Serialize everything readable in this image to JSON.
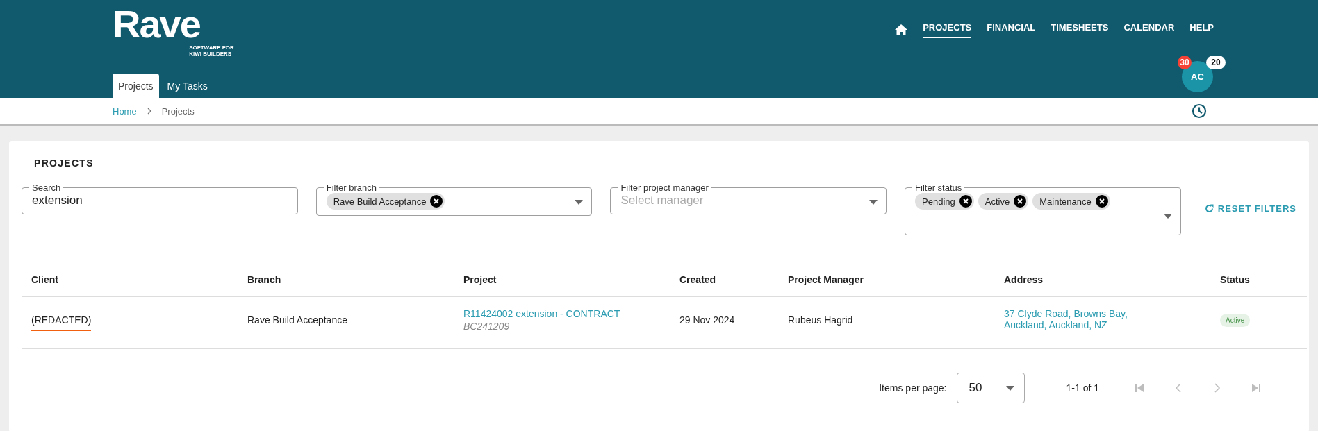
{
  "header": {
    "logo": {
      "wordmark": "Rave",
      "tagline": [
        "SOFTWARE FOR",
        "KIWI BUILDERS"
      ]
    },
    "nav": [
      {
        "label": "PROJECTS",
        "selected": true
      },
      {
        "label": "FINANCIAL",
        "selected": false
      },
      {
        "label": "TIMESHEETS",
        "selected": false
      },
      {
        "label": "CALENDAR",
        "selected": false
      },
      {
        "label": "HELP",
        "selected": false
      }
    ],
    "tabs": [
      {
        "label": "Projects",
        "selected": true
      },
      {
        "label": "My Tasks",
        "selected": false
      }
    ],
    "avatar": {
      "initials": "AC",
      "badges": [
        {
          "count": "30",
          "color": "#f44336"
        },
        {
          "count": "20",
          "color": "#ffffff"
        }
      ]
    }
  },
  "breadcrumb": [
    "Home",
    "Projects"
  ],
  "card": {
    "title": "PROJECTS",
    "filters": [
      {
        "kind": "text",
        "label": "Search",
        "value": "extension",
        "tall": false
      },
      {
        "kind": "select",
        "label": "Filter branch",
        "chips": [
          "Rave Build Acceptance"
        ],
        "tall": false
      },
      {
        "kind": "select",
        "label": "Filter project manager",
        "placeholder": "Select manager",
        "tall": false
      },
      {
        "kind": "select",
        "label": "Filter status",
        "chips": [
          "Pending",
          "Active",
          "Maintenance"
        ],
        "tall": true
      }
    ],
    "reset_button": "RESET FILTERS",
    "table": {
      "columns": [
        "Client",
        "Branch",
        "Project",
        "Created",
        "Project Manager",
        "Address",
        "Status"
      ],
      "rows": [
        {
          "client": "(REDACTED)",
          "client_underlined": true,
          "branch": "Rave Build Acceptance",
          "project": "R11424002 extension - CONTRACT",
          "project_code": "BC241209",
          "created": "29 Nov 2024",
          "manager": "Rubeus Hagrid",
          "address": "37 Clyde Road, Browns Bay, Auckland, Auckland, NZ",
          "status": "Active"
        }
      ]
    },
    "paginator": {
      "label": "Items per page:",
      "page_size": "50",
      "range": "1-1 of 1",
      "buttons": [
        {
          "kind": "first",
          "disabled": true
        },
        {
          "kind": "prev",
          "disabled": true
        },
        {
          "kind": "next",
          "disabled": true
        },
        {
          "kind": "last",
          "disabled": true
        }
      ]
    }
  }
}
